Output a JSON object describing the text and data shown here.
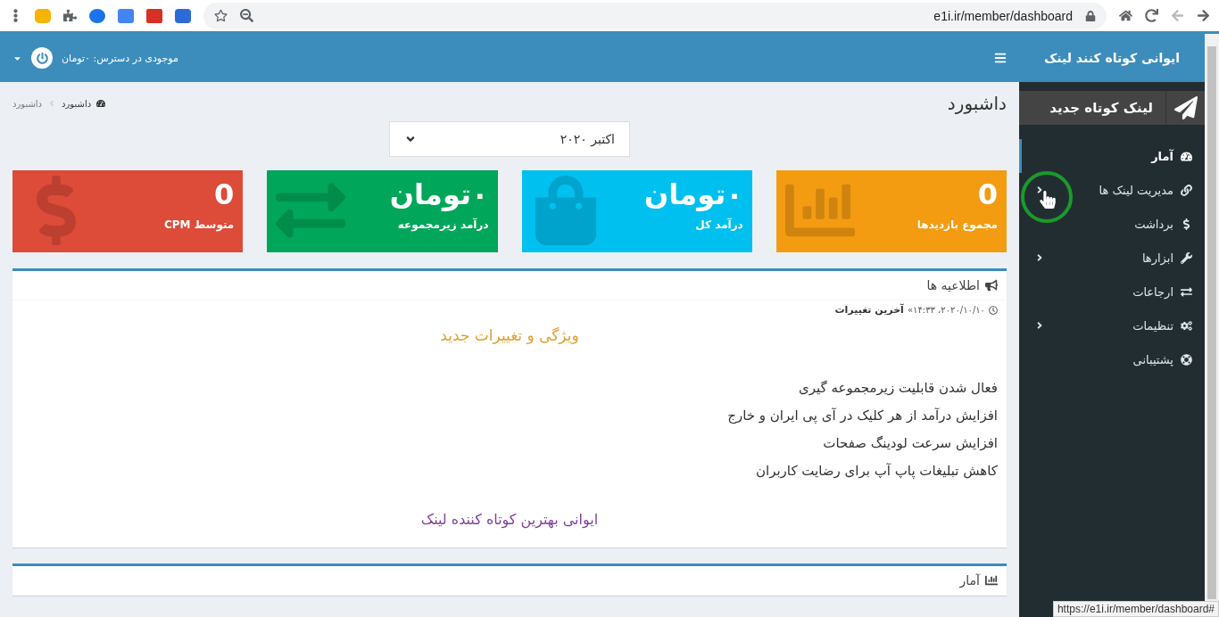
{
  "browser": {
    "url": "e1i.ir/member/dashboard"
  },
  "sidebar": {
    "brand": "ایوانی کوتاه کنند لینک",
    "new_link_button": "لینک کوتاه جدید",
    "items": [
      {
        "label": "آمار",
        "expandable": false,
        "selected": true
      },
      {
        "label": "مدیریت لینک ها",
        "expandable": true,
        "selected": false
      },
      {
        "label": "برداشت",
        "expandable": false,
        "selected": false
      },
      {
        "label": "ابزارها",
        "expandable": true,
        "selected": false
      },
      {
        "label": "ارجاعات",
        "expandable": false,
        "selected": false
      },
      {
        "label": "تنظیمات",
        "expandable": true,
        "selected": false
      },
      {
        "label": "پشتیبانی",
        "expandable": false,
        "selected": false
      }
    ]
  },
  "header": {
    "balance": "موجودی در دسترس: ۰تومان"
  },
  "page": {
    "title": "داشبورد",
    "breadcrumb": [
      {
        "label": "داشبورد",
        "selected": false
      },
      {
        "label": "داشبورد",
        "selected": true
      }
    ]
  },
  "month_select": {
    "value": "اکتبر ۲۰۲۰"
  },
  "stat_cards": [
    {
      "value": "0",
      "label": "مجموع بازدیدها",
      "color": "#f39c12"
    },
    {
      "value": "۰تومان",
      "label": "درآمد کل",
      "color": "#00c0ef"
    },
    {
      "value": "۰تومان",
      "label": "درآمد زیرمجموعه",
      "color": "#00a65a"
    },
    {
      "value": "0",
      "label": "متوسط CPM",
      "color": "#dd4b39"
    }
  ],
  "announcements": {
    "title": "اطلاعیه ها",
    "post_title": "آخرین تغییرات",
    "post_date": "۲۰۲۰/۱۰/۱۰، ۱۴:۳۳»",
    "heading": "ویژگی و تغییرات جدید",
    "lines": [
      "فعال شدن قابلیت زیرمجموعه گیری",
      "افزایش درآمد از هر کلیک در آی پی ایران و خارج",
      "افزایش سرعت لودینگ صفحات",
      "کاهش تبلیغات پاپ آپ برای رضایت کاربران"
    ],
    "footer": "ایوانی بهترین کوتاه کننده لینک"
  },
  "stats_panel": {
    "title": "آمار"
  },
  "status_url": "https://e1i.ir/member/dashboard#"
}
